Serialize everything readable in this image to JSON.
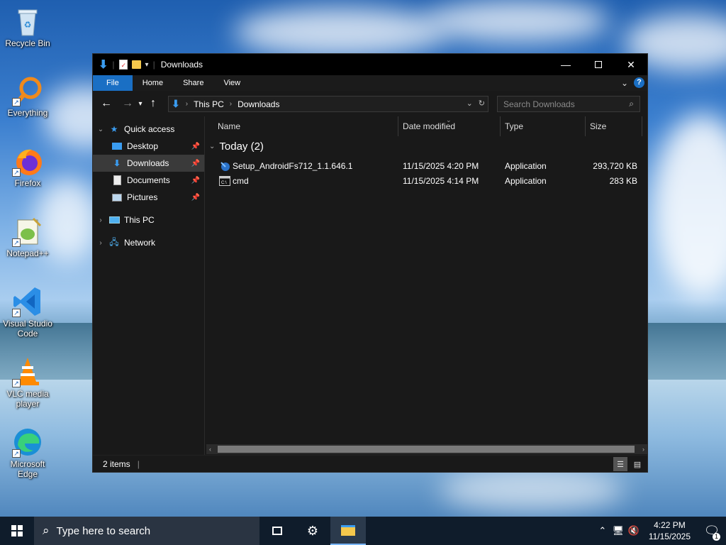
{
  "desktop": {
    "icons": [
      {
        "label": "Recycle Bin"
      },
      {
        "label": "Everything"
      },
      {
        "label": "Firefox"
      },
      {
        "label": "Notepad++"
      },
      {
        "label": "Visual Studio Code"
      },
      {
        "label": "VLC media player"
      },
      {
        "label": "Microsoft Edge"
      }
    ]
  },
  "window": {
    "title": "Downloads",
    "ribbon_tabs": [
      "File",
      "Home",
      "Share",
      "View"
    ],
    "address": {
      "crumbs": [
        "This PC",
        "Downloads"
      ]
    },
    "search": {
      "placeholder": "Search Downloads"
    },
    "nav": {
      "quick_access": "Quick access",
      "items": [
        {
          "label": "Desktop"
        },
        {
          "label": "Downloads"
        },
        {
          "label": "Documents"
        },
        {
          "label": "Pictures"
        }
      ],
      "this_pc": "This PC",
      "network": "Network"
    },
    "columns": {
      "name": "Name",
      "date": "Date modified",
      "type": "Type",
      "size": "Size"
    },
    "group_header": "Today (2)",
    "files": [
      {
        "name": "Setup_AndroidFs712_1.1.646.1",
        "date": "11/15/2025 4:20 PM",
        "type": "Application",
        "size": "293,720 KB",
        "icon": "setup-app-icon"
      },
      {
        "name": "cmd",
        "date": "11/15/2025 4:14 PM",
        "type": "Application",
        "size": "283 KB",
        "icon": "console-app-icon"
      }
    ],
    "status": "2 items"
  },
  "taskbar": {
    "search_placeholder": "Type here to search",
    "time": "4:22 PM",
    "date": "11/15/2025",
    "notifications": "1"
  },
  "colors": {
    "accent": "#1a6fc4",
    "window_bg": "#191919",
    "titlebar_bg": "#000000",
    "selected_nav": "#3a3a3a"
  }
}
